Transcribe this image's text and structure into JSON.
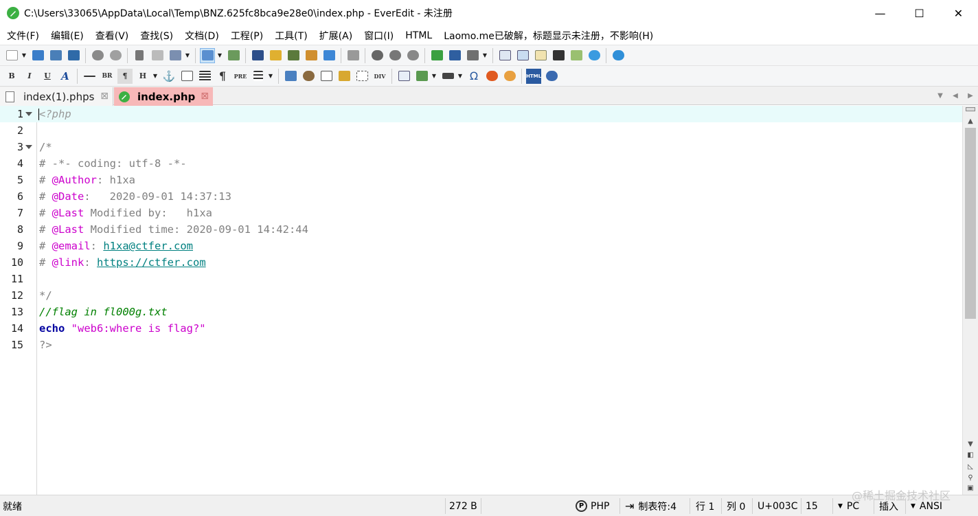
{
  "window": {
    "title": "C:\\Users\\33065\\AppData\\Local\\Temp\\BNZ.625fc8bca9e28e0\\index.php - EverEdit - 未注册",
    "minimize": "—",
    "maximize": "☐",
    "close": "✕"
  },
  "menu": [
    "文件(F)",
    "编辑(E)",
    "查看(V)",
    "查找(S)",
    "文档(D)",
    "工程(P)",
    "工具(T)",
    "扩展(A)",
    "窗口(I)",
    "HTML",
    "Laomo.me已破解，标题显示未注册，不影响(H)"
  ],
  "format_toolbar": {
    "bold": "B",
    "italic": "I",
    "underline": "U",
    "font": "A",
    "br": "BR",
    "para": "¶",
    "heading": "H",
    "pre": "PRE",
    "div": "DIV",
    "omega": "Ω",
    "html": "HTML"
  },
  "tabs": [
    {
      "label": "index(1).phps",
      "close": "⊠"
    },
    {
      "label": "index.php",
      "close": "⊠"
    }
  ],
  "editor": {
    "lines": [
      {
        "n": "1",
        "fold": true
      },
      {
        "n": "2",
        "fold": false
      },
      {
        "n": "3",
        "fold": true
      },
      {
        "n": "4",
        "fold": false
      },
      {
        "n": "5",
        "fold": false
      },
      {
        "n": "6",
        "fold": false
      },
      {
        "n": "7",
        "fold": false
      },
      {
        "n": "8",
        "fold": false
      },
      {
        "n": "9",
        "fold": false
      },
      {
        "n": "10",
        "fold": false
      },
      {
        "n": "11",
        "fold": false
      },
      {
        "n": "12",
        "fold": false
      },
      {
        "n": "13",
        "fold": false
      },
      {
        "n": "14",
        "fold": false
      },
      {
        "n": "15",
        "fold": false
      }
    ],
    "code": {
      "l1": "<?php",
      "l3": "/*",
      "l4": "# -*- coding: utf-8 -*-",
      "l5_hash": "# ",
      "l5_kw": "@Author",
      "l5_rest": ": h1xa",
      "l6_hash": "# ",
      "l6_kw": "@Date",
      "l6_rest": ":   2020-09-01 14:37:13",
      "l7_hash": "# ",
      "l7_kw": "@Last",
      "l7_rest": " Modified by:   h1xa",
      "l8_hash": "# ",
      "l8_kw": "@Last",
      "l8_rest": " Modified time: 2020-09-01 14:42:44",
      "l9_hash": "# ",
      "l9_kw": "@email",
      "l9_colon": ": ",
      "l9_link": "h1xa@ctfer.com",
      "l10_hash": "# ",
      "l10_kw": "@link",
      "l10_colon": ": ",
      "l10_link": "https://ctfer.com",
      "l12": "*/",
      "l13": "//flag in fl000g.txt",
      "l14_kw": "echo",
      "l14_str": " \"web6:where is flag?\"",
      "l15": "?>"
    }
  },
  "status": {
    "ready": "就绪",
    "size": "272 B",
    "lang_icon": "P",
    "lang": "PHP",
    "tab_arrow": "⇥",
    "tabs": "制表符:4",
    "row": "行 1",
    "col": "列 0",
    "unicode": "U+003C",
    "num": "15",
    "eol": "PC",
    "mode": "插入",
    "encoding": "ANSI"
  },
  "watermark": "@稀土掘金技术社区",
  "colors": {
    "accent": "#3cb043",
    "active_tab": "#f7b8b8",
    "current_line": "#e8fbfb",
    "comment": "#808080",
    "keyword": "#cc00cc",
    "link": "#008080",
    "green_comment": "#008000",
    "echo": "#0000a0"
  }
}
